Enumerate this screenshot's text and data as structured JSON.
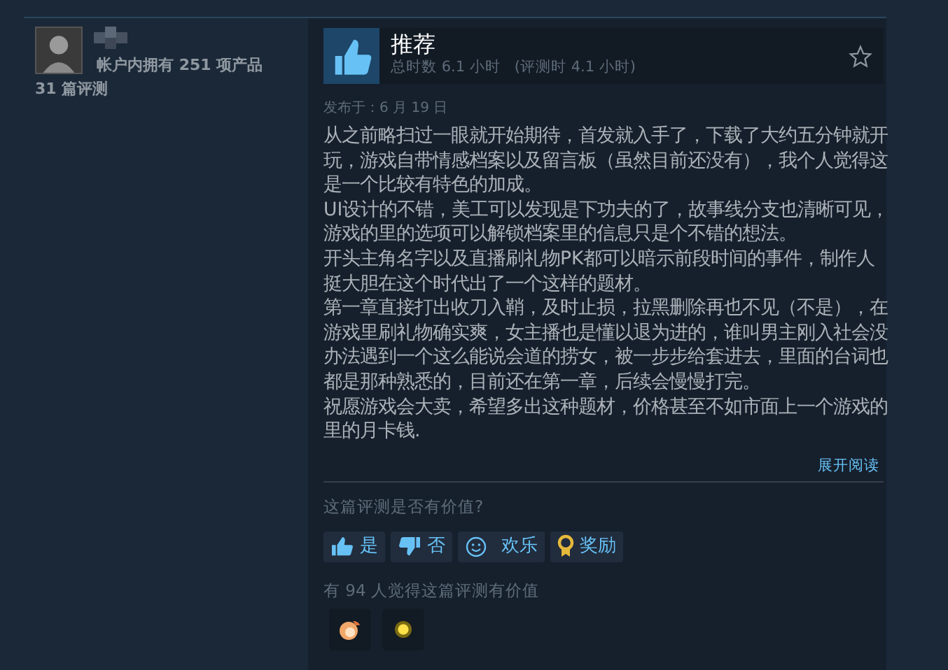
{
  "author": {
    "games_owned": "帐户内拥有 251 项产品",
    "reviews": "31 篇评测"
  },
  "review": {
    "verdict": "推荐",
    "recommended": true,
    "playtime": "总时数 6.1 小时   (评测时 4.1 小时)",
    "posted": "发布于：6 月 19 日",
    "paragraphs": [
      "从之前略扫过一眼就开始期待，首发就入手了，下载了大约五分钟就开玩，游戏自带情感档案以及留言板（虽然目前还没有），我个人觉得这是一个比较有特色的加成。",
      "UI设计的不错，美工可以发现是下功夫的了，故事线分支也清晰可见，游戏的里的选项可以解锁档案里的信息只是个不错的想法。",
      "开头主角名字以及直播刷礼物PK都可以暗示前段时间的事件，制作人挺大胆在这个时代出了一个这样的题材。",
      "第一章直接打出收刀入鞘，及时止损，拉黑删除再也不见（不是），在游戏里刷礼物确实爽，女主播也是懂以退为进的，谁叫男主刚入社会没办法遇到一个这么能说会道的捞女，被一步步给套进去，里面的台词也都是那种熟悉的，目前还在第一章，后续会慢慢打完。",
      "祝愿游戏会大卖，希望多出这种题材，价格甚至不如市面上一个游戏的里的月卡钱."
    ],
    "read_more": "展开阅读"
  },
  "helpful": {
    "question": "这篇评测是否有价值?",
    "buttons": [
      {
        "kind": "yes",
        "label": "是"
      },
      {
        "kind": "no",
        "label": "否"
      },
      {
        "kind": "funny",
        "label": "欢乐"
      },
      {
        "kind": "award",
        "label": "奖励"
      }
    ],
    "summary": "有 94 人觉得这篇评测有价值",
    "awards": [
      {
        "kind": "shrimp"
      },
      {
        "kind": "glow"
      }
    ]
  }
}
